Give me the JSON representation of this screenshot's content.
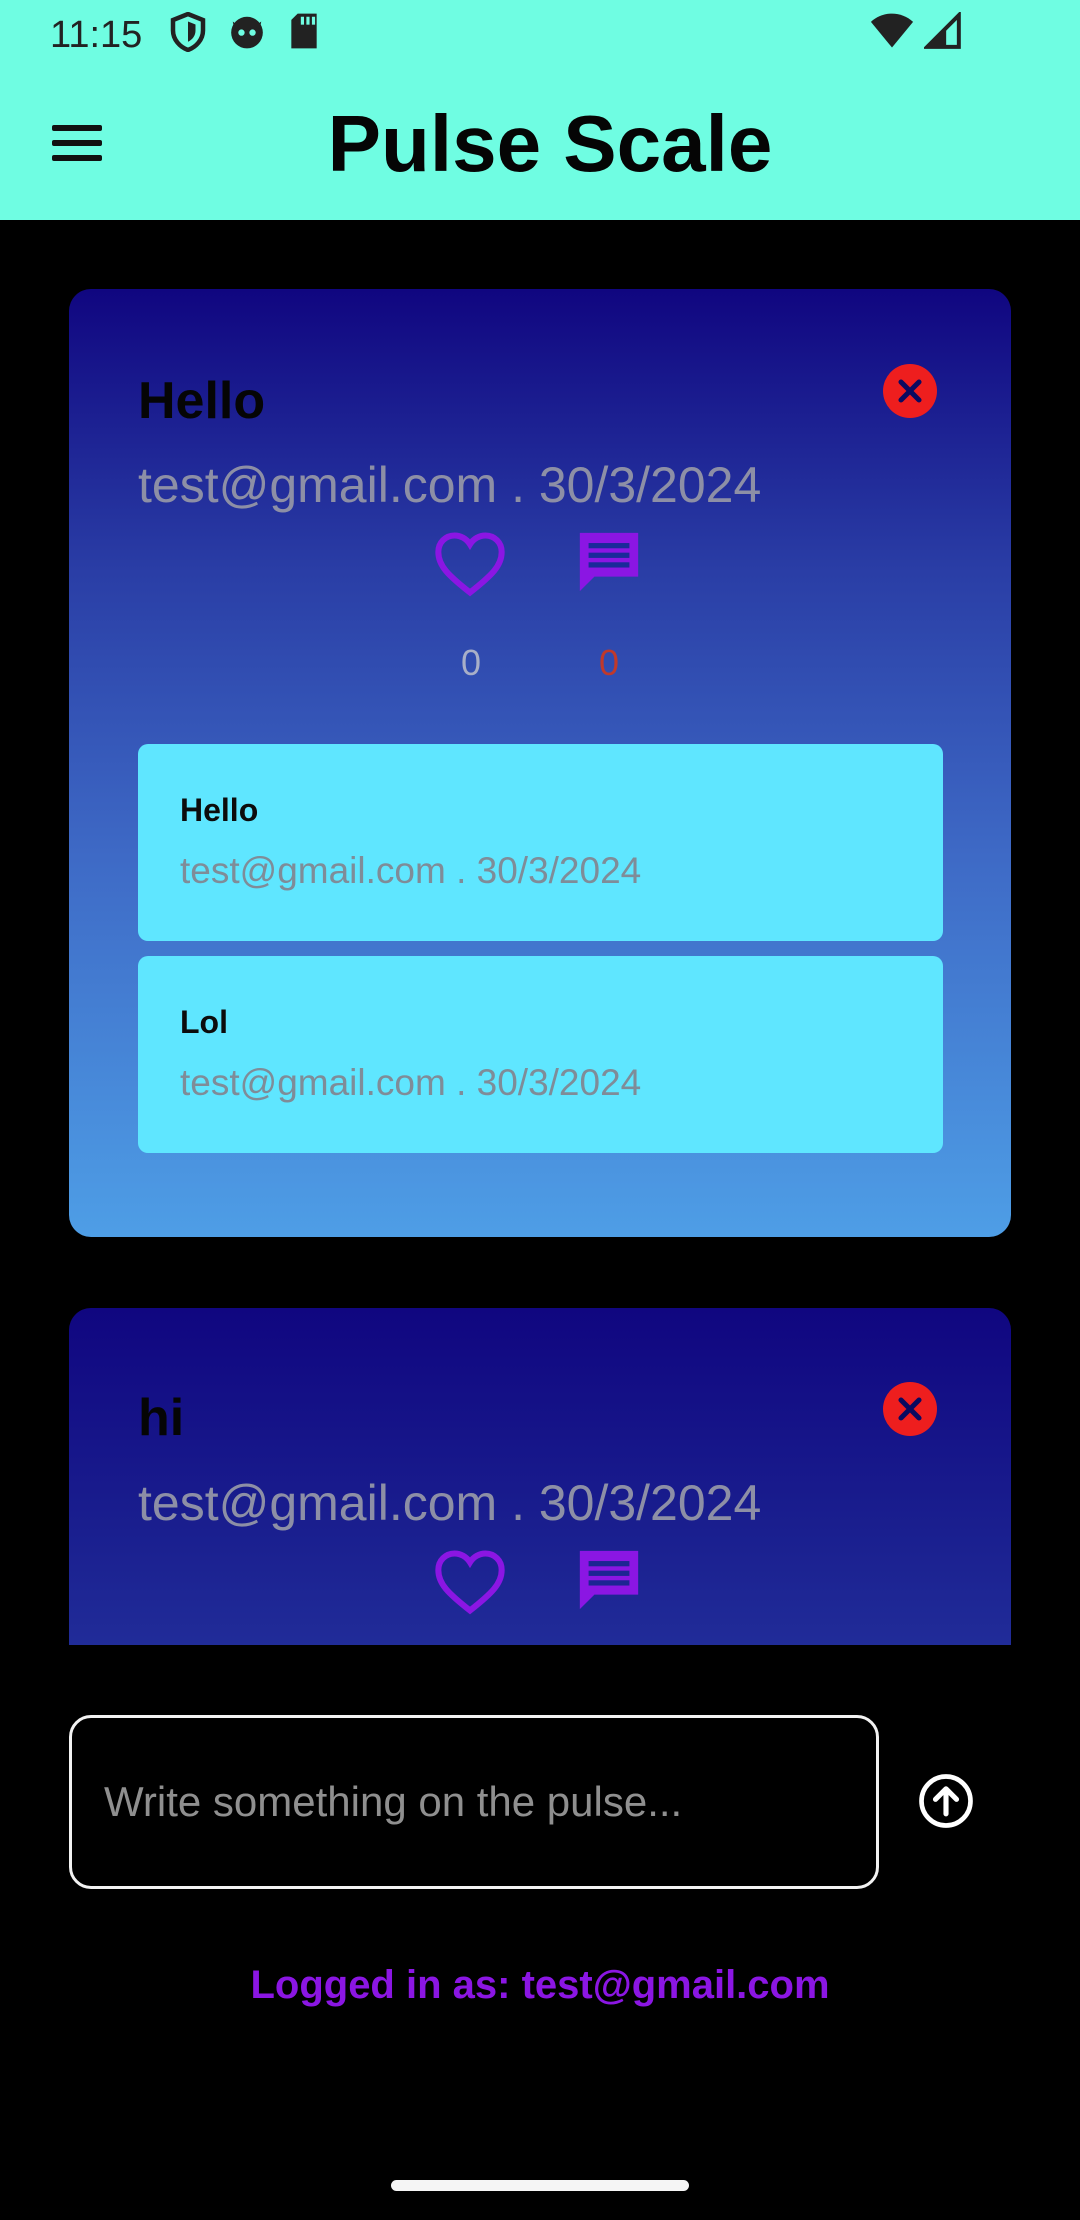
{
  "status_bar": {
    "time": "11:15",
    "icons": [
      "shield-icon",
      "cat-face-icon",
      "sd-card-icon",
      "wifi-icon",
      "signal-icon"
    ]
  },
  "app_bar": {
    "title": "Pulse Scale",
    "menu_icon": "hamburger-menu-icon"
  },
  "posts": [
    {
      "title": "Hello",
      "meta": "test@gmail.com . 30/3/2024",
      "likes": "0",
      "comments_count": "0",
      "comments": [
        {
          "text": "Hello",
          "meta": "test@gmail.com . 30/3/2024"
        },
        {
          "text": "Lol",
          "meta": "test@gmail.com . 30/3/2024"
        }
      ]
    },
    {
      "title": "hi",
      "meta": "test@gmail.com . 30/3/2024"
    }
  ],
  "composer": {
    "placeholder": "Write something on the pulse...",
    "send_icon": "arrow-up-circle-icon"
  },
  "footer": {
    "logged_in": "Logged in as: test@gmail.com"
  },
  "colors": {
    "app_bar_bg": "#6ffde2",
    "background": "#000000",
    "card_top": "#100680",
    "card_bottom": "#4e9ee6",
    "comment_bg": "#5fe6ff",
    "accent_purple": "#8b16e3",
    "delete_red": "#ee1e1e",
    "comment_count_red": "#c0392b"
  }
}
